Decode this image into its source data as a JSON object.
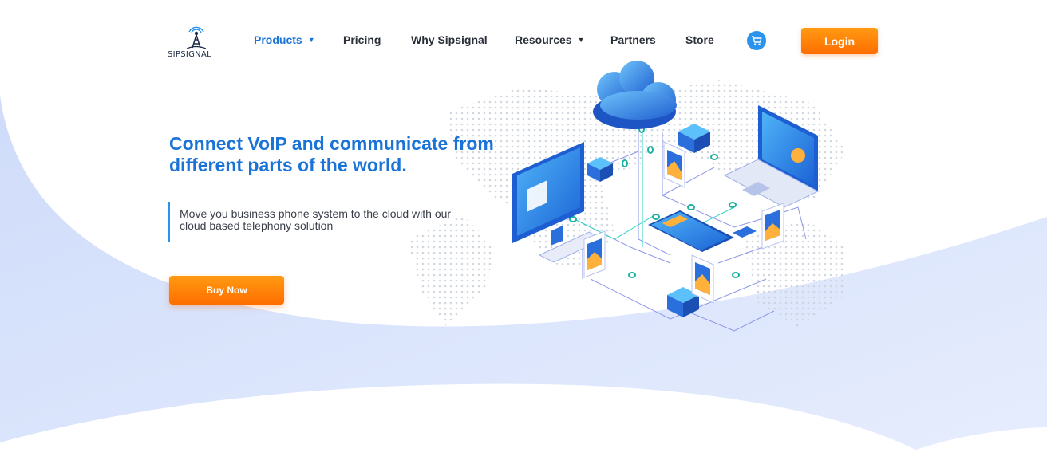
{
  "brand": {
    "name": "SIPSIGNAL",
    "logo_icon": "antenna-tower-icon"
  },
  "nav": {
    "items": [
      {
        "label": "Products",
        "has_dropdown": true,
        "active": true
      },
      {
        "label": "Pricing",
        "has_dropdown": false,
        "active": false
      },
      {
        "label": "Why Sipsignal",
        "has_dropdown": false,
        "active": false
      },
      {
        "label": "Resources",
        "has_dropdown": true,
        "active": false
      },
      {
        "label": "Partners",
        "has_dropdown": false,
        "active": false
      },
      {
        "label": "Store",
        "has_dropdown": false,
        "active": false
      }
    ],
    "cart_icon": "cart-icon",
    "login_label": "Login"
  },
  "hero": {
    "title": "Connect VoIP and communicate from different parts of the world.",
    "subtitle": "Move you business phone system to the cloud with our cloud based telephony solution",
    "cta_label": "Buy Now",
    "illustration": "isometric-cloud-network-illustration"
  },
  "colors": {
    "primary_blue": "#1a73d6",
    "accent_orange": "#ff7a00",
    "wave_blue": "#d9e3fb",
    "text_dark": "#2a2f3a"
  }
}
